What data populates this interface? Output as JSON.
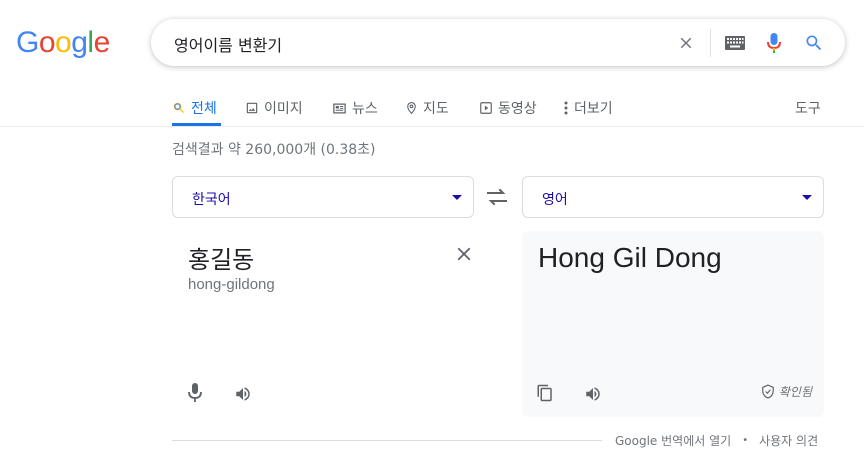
{
  "logo": {
    "letters": [
      "G",
      "o",
      "o",
      "g",
      "l",
      "e"
    ],
    "colors": [
      "#4285f4",
      "#ea4335",
      "#fbbc05",
      "#4285f4",
      "#34a853",
      "#ea4335"
    ]
  },
  "search": {
    "query": "영어이름 변환기"
  },
  "tabs": [
    {
      "label": "전체",
      "icon": "search-icon",
      "active": true
    },
    {
      "label": "이미지",
      "icon": "image-icon",
      "active": false
    },
    {
      "label": "뉴스",
      "icon": "news-icon",
      "active": false
    },
    {
      "label": "지도",
      "icon": "map-pin-icon",
      "active": false
    },
    {
      "label": "동영상",
      "icon": "video-icon",
      "active": false
    },
    {
      "label": "더보기",
      "icon": "more-vert-icon",
      "active": false
    }
  ],
  "tools_label": "도구",
  "result_stats": "검색결과 약 260,000개 (0.38초)",
  "translator": {
    "source_lang": "한국어",
    "target_lang": "영어",
    "source_text": "홍길동",
    "source_romanization": "hong-gildong",
    "target_text": "Hong Gil Dong",
    "verified_label": "확인됨"
  },
  "footer": {
    "open_translate": "Google 번역에서 열기",
    "separator": "•",
    "feedback": "사용자 의견"
  },
  "colors": {
    "accent": "#1a73e8",
    "link": "#1a0dab",
    "muted": "#70757a",
    "mic_blue": "#4285f4",
    "mic_red": "#ea4335",
    "mic_yellow": "#fbbc05",
    "mic_green": "#34a853"
  }
}
